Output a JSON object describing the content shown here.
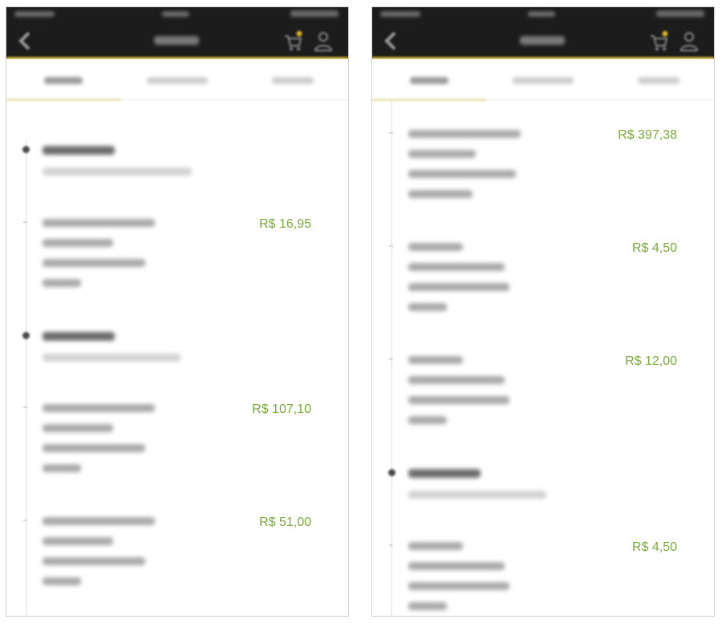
{
  "colors": {
    "amount_green": "#7aa93c",
    "topbar": "#1c1c1c",
    "accent_yellow": "#f2d23c"
  },
  "icons": [
    "back-icon",
    "cart-icon",
    "user-icon"
  ],
  "left_screen": {
    "entries": [
      {
        "amount": "R$ 16,95"
      },
      {
        "amount": "R$ 107,10"
      },
      {
        "amount": "R$ 51,00"
      }
    ]
  },
  "right_screen": {
    "entries": [
      {
        "amount": "R$ 397,38"
      },
      {
        "amount": "R$ 4,50"
      },
      {
        "amount": "R$ 12,00"
      },
      {
        "amount": "R$ 4,50"
      }
    ]
  }
}
